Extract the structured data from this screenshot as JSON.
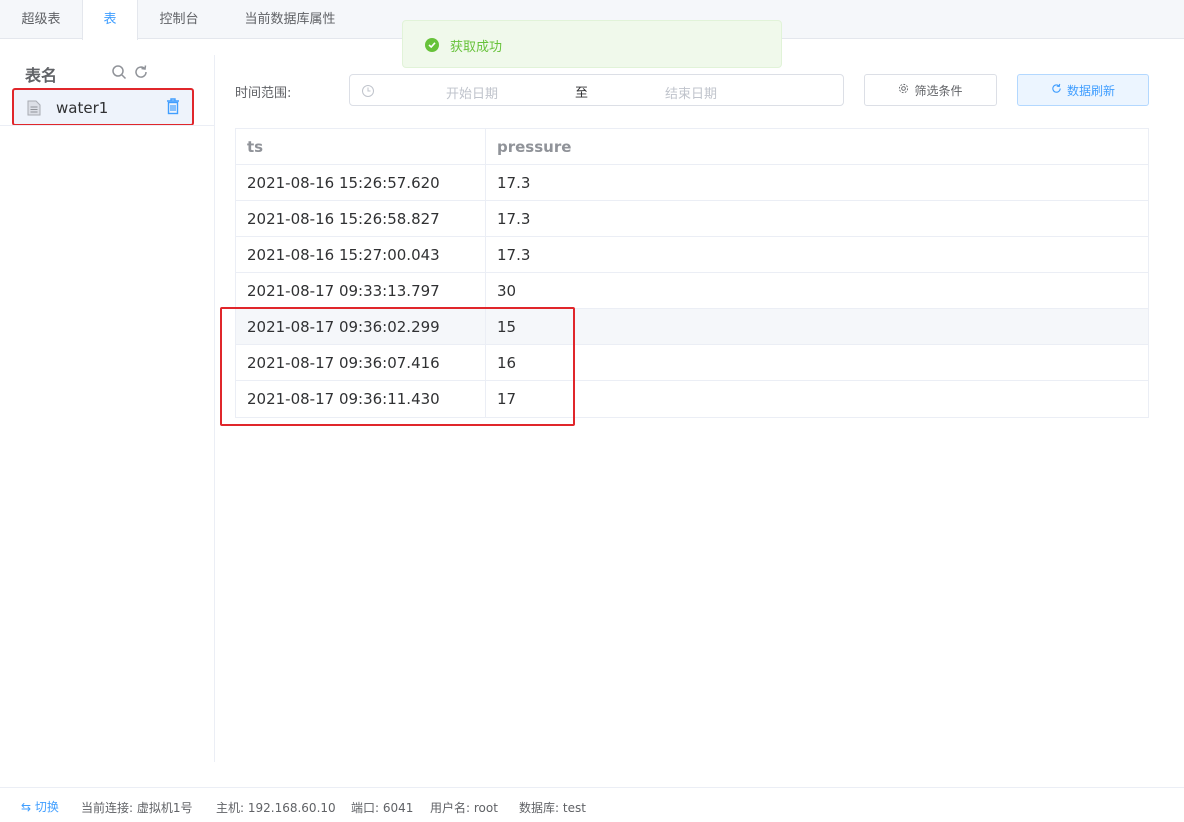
{
  "tabs": [
    "超级表",
    "表",
    "控制台",
    "当前数据库属性"
  ],
  "toast": {
    "message": "获取成功",
    "color": "#67c23a"
  },
  "sidebar": {
    "title": "表名",
    "items": [
      {
        "label": "water1",
        "highlighted": true
      }
    ]
  },
  "filter": {
    "range_label": "时间范围:",
    "start_placeholder": "开始日期",
    "separator": "至",
    "end_placeholder": "结束日期",
    "filter_button": "筛选条件",
    "refresh_button": "数据刷新"
  },
  "table": {
    "columns": [
      "ts",
      "pressure"
    ],
    "rows": [
      [
        "2021-08-16 15:26:57.620",
        "17.3"
      ],
      [
        "2021-08-16 15:26:58.827",
        "17.3"
      ],
      [
        "2021-08-16 15:27:00.043",
        "17.3"
      ],
      [
        "2021-08-17 09:33:13.797",
        "30"
      ],
      [
        "2021-08-17 09:36:02.299",
        "15"
      ],
      [
        "2021-08-17 09:36:07.416",
        "16"
      ],
      [
        "2021-08-17 09:36:11.430",
        "17"
      ]
    ]
  },
  "footer": {
    "switch_label": "切换",
    "connection": "当前连接: 虚拟机1号",
    "host": "主机: 192.168.60.10",
    "port": "端口: 6041",
    "user": "用户名: root",
    "database": "数据库: test"
  },
  "colors": {
    "accent": "#409eff",
    "annotation": "#e0262b"
  }
}
